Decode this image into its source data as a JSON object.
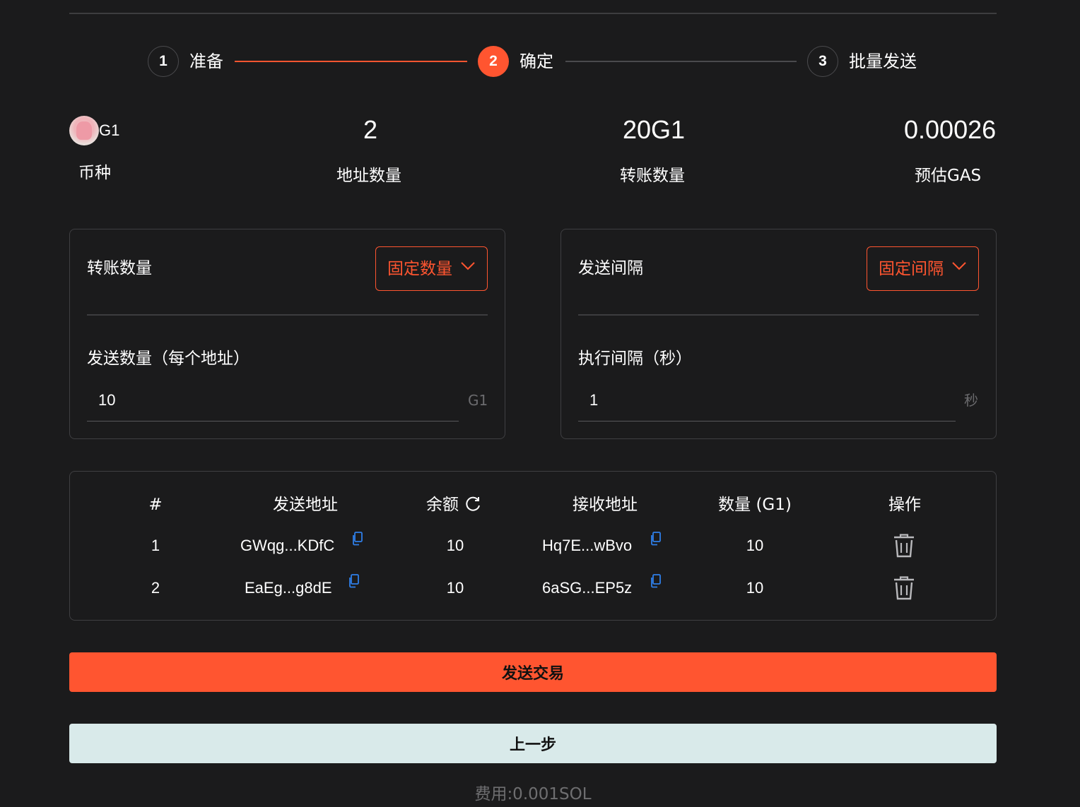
{
  "stepper": {
    "steps": [
      {
        "number": "1",
        "label": "准备",
        "state": "done"
      },
      {
        "number": "2",
        "label": "确定",
        "state": "active"
      },
      {
        "number": "3",
        "label": "批量发送",
        "state": "pending"
      }
    ],
    "accent_color": "#ff5530"
  },
  "summary": {
    "token": {
      "symbol": "G1",
      "label": "币种",
      "icon": "token-avatar"
    },
    "address_count": {
      "value": "2",
      "label": "地址数量"
    },
    "transfer_amount": {
      "value": "20G1",
      "label": "转账数量"
    },
    "gas": {
      "value": "0.00026",
      "label": "预估GAS"
    }
  },
  "amount_card": {
    "title": "转账数量",
    "mode": "固定数量",
    "field_label": "发送数量（每个地址）",
    "value": "10",
    "unit": "G1"
  },
  "interval_card": {
    "title": "发送间隔",
    "mode": "固定间隔",
    "field_label": "执行间隔（秒）",
    "value": "1",
    "unit": "秒"
  },
  "table": {
    "headers": {
      "index": "#",
      "from": "发送地址",
      "balance": "余额",
      "to": "接收地址",
      "amount": "数量 (G1)",
      "action": "操作"
    },
    "rows": [
      {
        "index": "1",
        "from": "GWqg...KDfC",
        "balance": "10",
        "to": "Hq7E...wBvo",
        "amount": "10"
      },
      {
        "index": "2",
        "from": "EaEg...g8dE",
        "balance": "10",
        "to": "6aSG...EP5z",
        "amount": "10"
      }
    ]
  },
  "actions": {
    "send": "发送交易",
    "back": "上一步"
  },
  "fee": "费用:0.001SOL"
}
